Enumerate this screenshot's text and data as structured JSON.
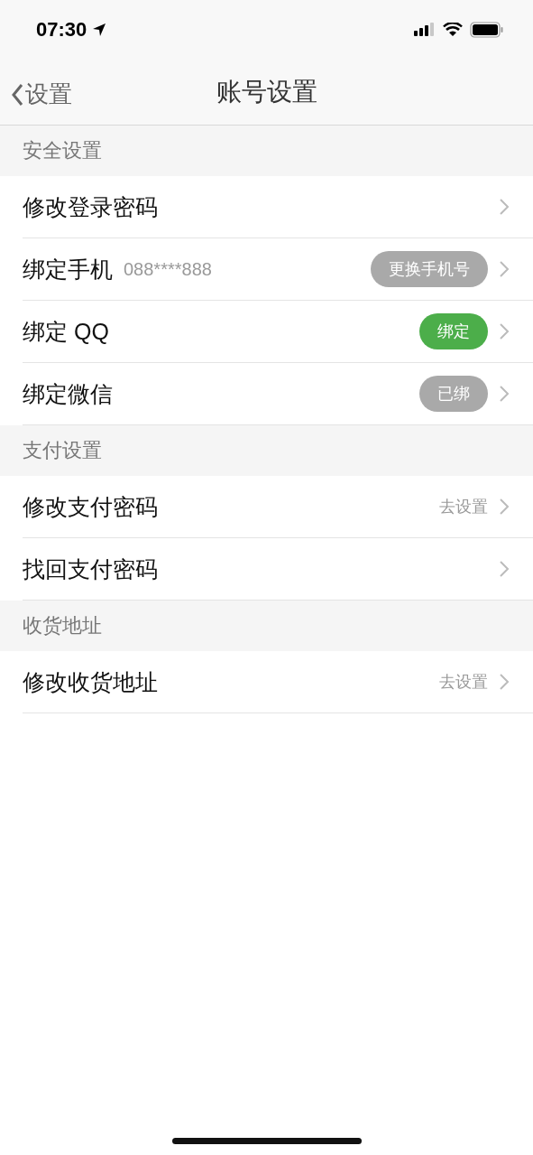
{
  "status_bar": {
    "time": "07:30"
  },
  "nav": {
    "back": "设置",
    "title": "账号设置"
  },
  "sections": [
    {
      "title": "安全设置",
      "rows": [
        {
          "label": "修改登录密码"
        },
        {
          "label": "绑定手机",
          "detail": "088****888",
          "badge": {
            "text": "更换手机号",
            "active": false
          }
        },
        {
          "label": "绑定 QQ",
          "badge": {
            "text": "绑定",
            "active": true
          }
        },
        {
          "label": "绑定微信",
          "badge": {
            "text": "已绑",
            "active": false
          }
        }
      ]
    },
    {
      "title": "支付设置",
      "rows": [
        {
          "label": "修改支付密码",
          "hint": "去设置"
        },
        {
          "label": "找回支付密码"
        }
      ]
    },
    {
      "title": "收货地址",
      "rows": [
        {
          "label": "修改收货地址",
          "hint": "去设置"
        }
      ]
    }
  ]
}
